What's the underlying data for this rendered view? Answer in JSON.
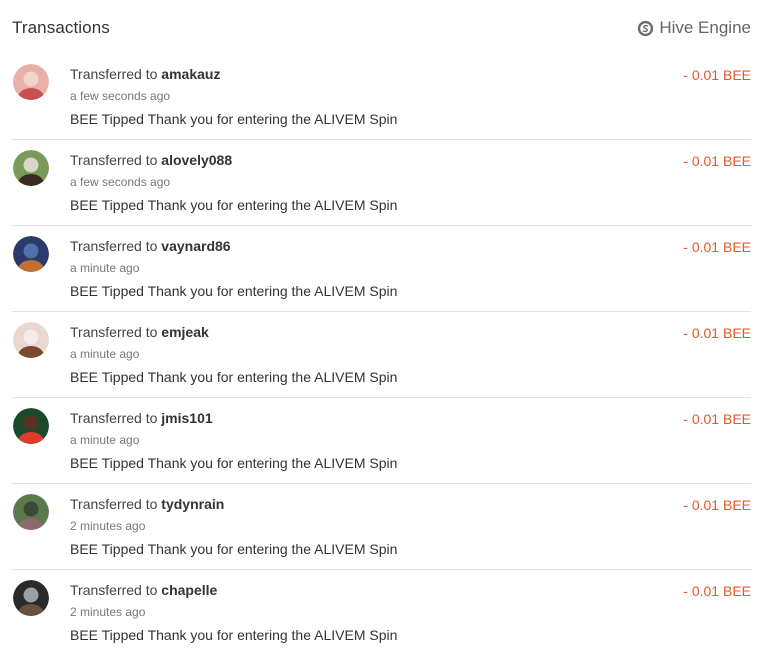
{
  "header": {
    "title": "Transactions",
    "engine_label": "Hive Engine"
  },
  "colors": {
    "amount": "#e0592a",
    "divider": "#e3e3e3"
  },
  "transactions": [
    {
      "prefix": "Transferred to",
      "user": "amakauz",
      "time": "a few seconds ago",
      "memo": "BEE Tipped Thank you for entering the ALIVEM Spin",
      "amount": "- 0.01 BEE",
      "avatar_colors": [
        "#e8b0a8",
        "#c85050",
        "#f2d4cc"
      ]
    },
    {
      "prefix": "Transferred to",
      "user": "alovely088",
      "time": "a few seconds ago",
      "memo": "BEE Tipped Thank you for entering the ALIVEM Spin",
      "amount": "- 0.01 BEE",
      "avatar_colors": [
        "#7a9a5a",
        "#3a2a20",
        "#d8d8c8"
      ]
    },
    {
      "prefix": "Transferred to",
      "user": "vaynard86",
      "time": "a minute ago",
      "memo": "BEE Tipped Thank you for entering the ALIVEM Spin",
      "amount": "- 0.01 BEE",
      "avatar_colors": [
        "#2a3a6a",
        "#c07030",
        "#5070b0"
      ]
    },
    {
      "prefix": "Transferred to",
      "user": "emjeak",
      "time": "a minute ago",
      "memo": "BEE Tipped Thank you for entering the ALIVEM Spin",
      "amount": "- 0.01 BEE",
      "avatar_colors": [
        "#e8d8d0",
        "#7a4a30",
        "#f4ece8"
      ]
    },
    {
      "prefix": "Transferred to",
      "user": "jmis101",
      "time": "a minute ago",
      "memo": "BEE Tipped Thank you for entering the ALIVEM Spin",
      "amount": "- 0.01 BEE",
      "avatar_colors": [
        "#1a4a2a",
        "#e03a2a",
        "#5a3020"
      ]
    },
    {
      "prefix": "Transferred to",
      "user": "tydynrain",
      "time": "2 minutes ago",
      "memo": "BEE Tipped Thank you for entering the ALIVEM Spin",
      "amount": "- 0.01 BEE",
      "avatar_colors": [
        "#5a7a4a",
        "#8a6a6a",
        "#3a4a3a"
      ]
    },
    {
      "prefix": "Transferred to",
      "user": "chapelle",
      "time": "2 minutes ago",
      "memo": "BEE Tipped Thank you for entering the ALIVEM Spin",
      "amount": "- 0.01 BEE",
      "avatar_colors": [
        "#2a2a2a",
        "#6a5040",
        "#9aa0a8"
      ]
    }
  ]
}
